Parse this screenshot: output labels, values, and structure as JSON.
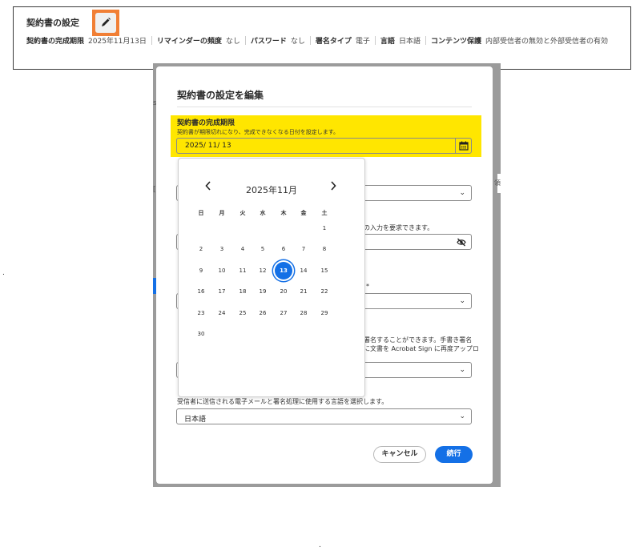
{
  "summary": {
    "title": "契約書の設定",
    "items": [
      {
        "label": "契約書の完成期限",
        "value": "2025年11月13日"
      },
      {
        "label": "リマインダーの頻度",
        "value": "なし"
      },
      {
        "label": "パスワード",
        "value": "なし"
      },
      {
        "label": "署名タイプ",
        "value": "電子"
      },
      {
        "label": "言語",
        "value": "日本語"
      },
      {
        "label": "コンテンツ保護",
        "value": "内部受信者の無効と外部受信者の有効"
      }
    ]
  },
  "background": {
    "dot1": ".",
    "dot2": ".",
    "frag_s": "s",
    "frag_bracket": "[",
    "frag_ryo": "領"
  },
  "dialog": {
    "title": "契約書の設定を編集",
    "deadline": {
      "label": "契約書の完成期限",
      "description": "契約書が期限切れになり、完成できなくなる日付を設定します。",
      "value": "2025/  11/  13"
    },
    "password_hint": "の入力を要求できます。",
    "required_mark": "*",
    "sign_hint_1": "署名することができます。手書き署名",
    "sign_hint_2": "に文書を Acrobat Sign に再度アップロ",
    "language": {
      "description": "受信者に送信される電子メールと署名処理に使用する言語を選択します。",
      "value": "日本語"
    },
    "cancel_label": "キャンセル",
    "continue_label": "続行"
  },
  "calendar": {
    "month_label": "2025年11月",
    "weekdays": [
      "日",
      "月",
      "火",
      "水",
      "木",
      "金",
      "土"
    ],
    "first_weekday": 6,
    "days_in_month": 30,
    "selected_day": 13
  },
  "colors": {
    "highlight_yellow": "#ffe600",
    "accent_blue": "#1470e6",
    "edit_highlight_orange": "#f17f35"
  },
  "icons": [
    "pencil-icon",
    "calendar-icon",
    "chevron-down-icon",
    "eye-off-icon",
    "chevron-left-icon",
    "chevron-right-icon"
  ]
}
